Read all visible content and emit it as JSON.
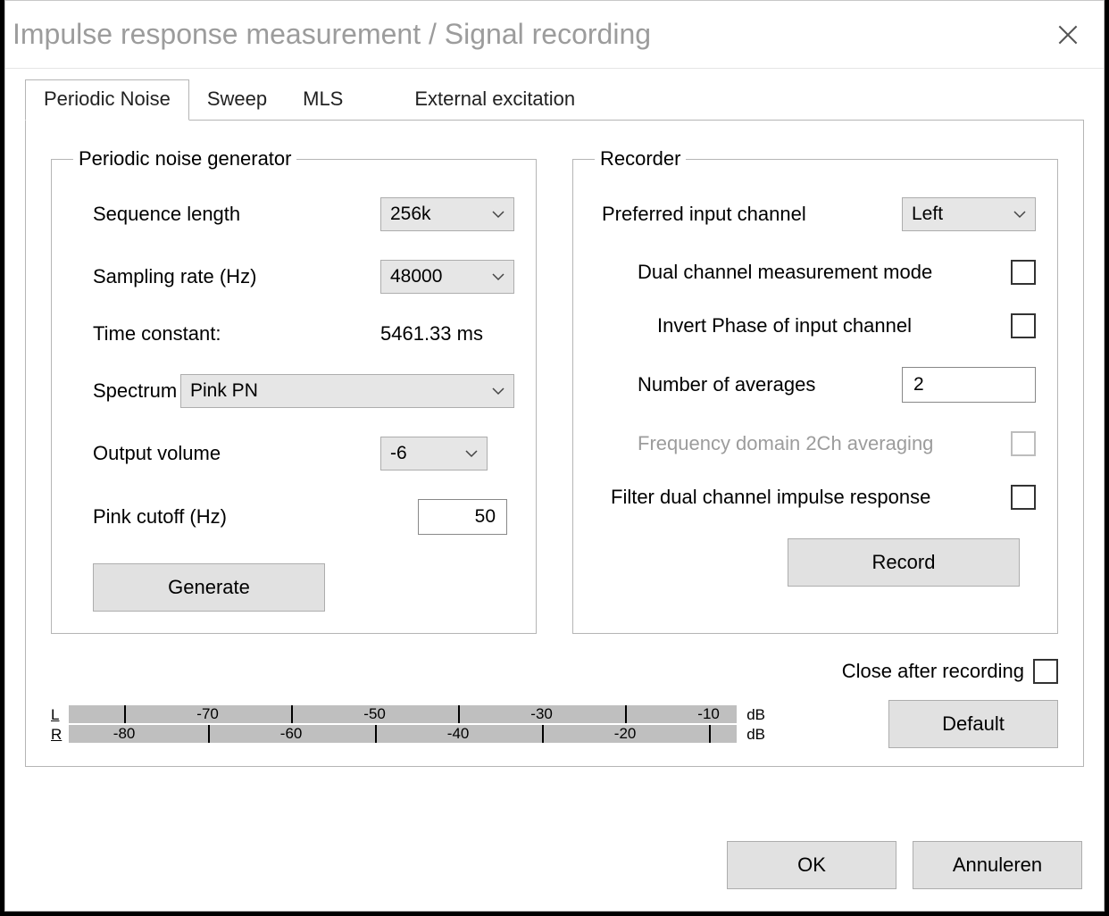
{
  "window": {
    "title": "Impulse response measurement / Signal recording"
  },
  "tabs": {
    "periodic_noise": "Periodic Noise",
    "sweep": "Sweep",
    "mls": "MLS",
    "external": "External excitation"
  },
  "generator": {
    "legend": "Periodic noise generator",
    "sequence_length_label": "Sequence length",
    "sequence_length_value": "256k",
    "sampling_rate_label": "Sampling rate (Hz)",
    "sampling_rate_value": "48000",
    "time_constant_label": "Time constant:",
    "time_constant_value": "5461.33 ms",
    "spectrum_label": "Spectrum",
    "spectrum_value": "Pink PN",
    "output_volume_label": "Output volume",
    "output_volume_value": "-6",
    "pink_cutoff_label": "Pink cutoff (Hz)",
    "pink_cutoff_value": "50",
    "generate_button": "Generate"
  },
  "recorder": {
    "legend": "Recorder",
    "preferred_input_label": "Preferred input channel",
    "preferred_input_value": "Left",
    "dual_channel_label": "Dual channel measurement mode",
    "invert_phase_label": "Invert Phase of input channel",
    "num_averages_label": "Number of averages",
    "num_averages_value": "2",
    "freq_domain_label": "Frequency domain 2Ch averaging",
    "filter_dual_label": "Filter dual channel impulse response",
    "record_button": "Record"
  },
  "close_after_label": "Close after recording",
  "meter": {
    "L": "L",
    "R": "R",
    "unit": "dB",
    "top_ticks": [
      "-70",
      "-50",
      "-30",
      "-10"
    ],
    "bot_ticks": [
      "-80",
      "-60",
      "-40",
      "-20"
    ]
  },
  "buttons": {
    "default": "Default",
    "ok": "OK",
    "cancel": "Annuleren"
  }
}
